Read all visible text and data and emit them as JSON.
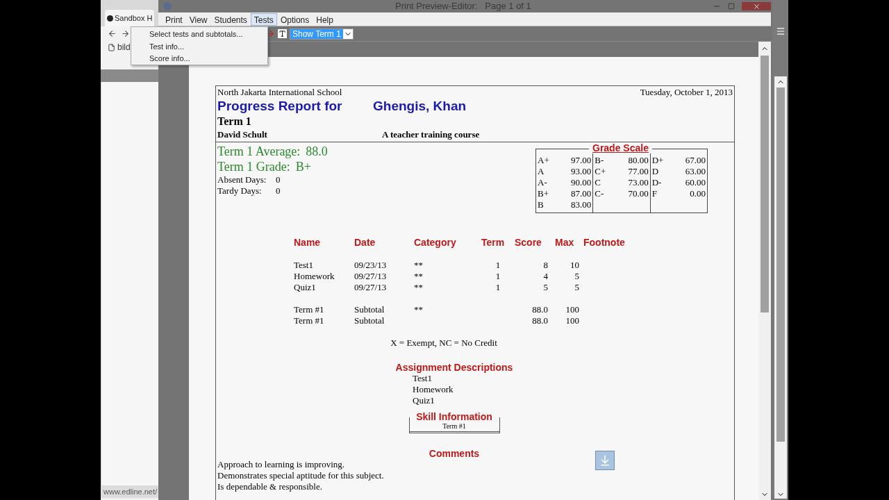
{
  "browser": {
    "tab_title": "Sandbox H",
    "bookmark": "bild",
    "status_url": "www.edline.net/"
  },
  "window": {
    "title": "Print Preview-Editor:   Page 1 of 1"
  },
  "menu": [
    {
      "label": "Print",
      "selected": false
    },
    {
      "label": "View",
      "selected": false
    },
    {
      "label": "Students",
      "selected": false
    },
    {
      "label": "Tests",
      "selected": true
    },
    {
      "label": "Options",
      "selected": false
    },
    {
      "label": "Help",
      "selected": false
    }
  ],
  "open_menu": {
    "items": [
      "Select tests and subtotals...",
      "Test info...",
      "Score info..."
    ]
  },
  "toolbar": {
    "term_select": "Show Term 1"
  },
  "report": {
    "school": "North Jakarta International School",
    "date": "Tuesday, October 1, 2013",
    "title": "Progress Report for",
    "student": "Ghengis, Khan",
    "term": "Term 1",
    "teacher": "David Schult",
    "course": "A teacher training course",
    "average_label": "Term 1 Average:",
    "average": "88.0",
    "grade_label": "Term 1 Grade:",
    "grade": "B+",
    "absent_label": "Absent Days:",
    "absent": "0",
    "tardy_label": "Tardy Days:",
    "tardy": "0",
    "grade_scale": {
      "title": "Grade Scale",
      "columns": [
        [
          {
            "grade": "A+",
            "cutoff": "97.00"
          },
          {
            "grade": "A",
            "cutoff": "93.00"
          },
          {
            "grade": "A-",
            "cutoff": "90.00"
          },
          {
            "grade": "B+",
            "cutoff": "87.00"
          },
          {
            "grade": "B",
            "cutoff": "83.00"
          }
        ],
        [
          {
            "grade": "B-",
            "cutoff": "80.00"
          },
          {
            "grade": "C+",
            "cutoff": "77.00"
          },
          {
            "grade": "C",
            "cutoff": "73.00"
          },
          {
            "grade": "C-",
            "cutoff": "70.00"
          }
        ],
        [
          {
            "grade": "D+",
            "cutoff": "67.00"
          },
          {
            "grade": "D",
            "cutoff": "63.00"
          },
          {
            "grade": "D-",
            "cutoff": "60.00"
          },
          {
            "grade": "F",
            "cutoff": "0.00"
          }
        ]
      ]
    },
    "scores": {
      "columns": [
        "Name",
        "Date",
        "Category",
        "Term",
        "Score",
        "Max",
        "Footnote"
      ],
      "rows": [
        {
          "name": "Test1",
          "date": "09/23/13",
          "category": "**",
          "term": "1",
          "score": "8",
          "max": "10"
        },
        {
          "name": "Homework",
          "date": "09/27/13",
          "category": "**",
          "term": "1",
          "score": "4",
          "max": "5"
        },
        {
          "name": "Quiz1",
          "date": "09/27/13",
          "category": "**",
          "term": "1",
          "score": "5",
          "max": "5"
        }
      ],
      "subtotals": [
        {
          "name": "Term #1",
          "date": "Subtotal",
          "category": "**",
          "score": "88.0",
          "max": "100"
        },
        {
          "name": "Term #1",
          "date": "Subtotal",
          "score": "88.0",
          "max": "100"
        }
      ]
    },
    "legend": "X = Exempt, NC = No Credit",
    "assignment_descriptions": {
      "title": "Assignment Descriptions",
      "items": [
        "Test1",
        "Homework",
        "Quiz1"
      ]
    },
    "skill_information": {
      "title": "Skill Information",
      "term": "Term #1"
    },
    "comments": {
      "title": "Comments",
      "items": [
        "Approach to learning is improving.",
        "Demonstrates special aptitude for this subject.",
        "Is dependable & responsible."
      ]
    }
  }
}
